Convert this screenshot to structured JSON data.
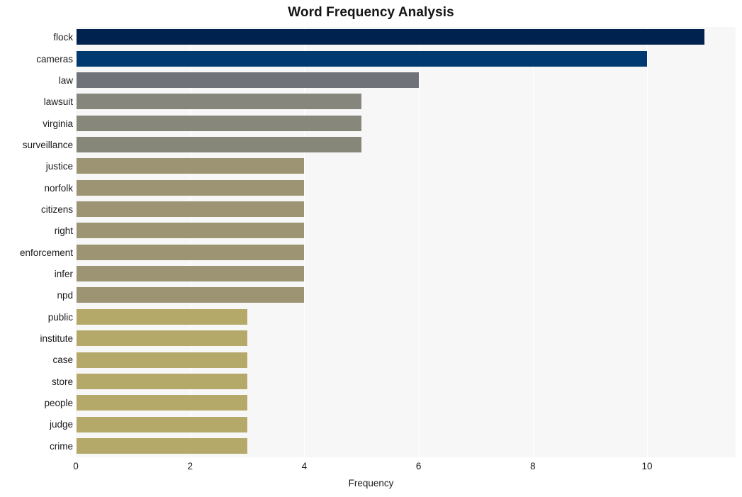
{
  "chart_data": {
    "type": "bar",
    "orientation": "horizontal",
    "title": "Word Frequency Analysis",
    "xlabel": "Frequency",
    "ylabel": "",
    "categories": [
      "flock",
      "cameras",
      "law",
      "lawsuit",
      "virginia",
      "surveillance",
      "justice",
      "norfolk",
      "citizens",
      "right",
      "enforcement",
      "infer",
      "npd",
      "public",
      "institute",
      "case",
      "store",
      "people",
      "judge",
      "crime"
    ],
    "values": [
      11,
      10,
      6,
      5,
      5,
      5,
      4,
      4,
      4,
      4,
      4,
      4,
      4,
      3,
      3,
      3,
      3,
      3,
      3,
      3
    ],
    "bar_colors": [
      "#00224e",
      "#003a70",
      "#6f7278",
      "#86867c",
      "#87877b",
      "#868679",
      "#9c9473",
      "#9c9473",
      "#9c9473",
      "#9c9473",
      "#9c9473",
      "#9c9473",
      "#9c9473",
      "#b5a96a",
      "#b5a96a",
      "#b5a96a",
      "#b5a96a",
      "#b5a96a",
      "#b5a96a",
      "#b5a96a"
    ],
    "xlim": [
      0,
      11.55
    ],
    "xticks": [
      0,
      2,
      4,
      6,
      8,
      10
    ],
    "xtick_labels": [
      "0",
      "2",
      "4",
      "6",
      "8",
      "10"
    ],
    "grid": true,
    "grid_axis": "x",
    "legend": null,
    "plot_background": "#f7f7f7",
    "figure_background": "#ffffff",
    "colormap": "cividis"
  }
}
